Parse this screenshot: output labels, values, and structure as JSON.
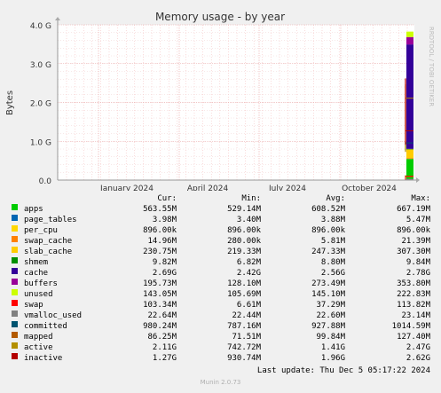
{
  "chart_data": {
    "type": "area",
    "title": "Memory usage - by year",
    "ylabel": "Bytes",
    "side_label": "RRDTOOL / TOBI OETIKER",
    "yticks": [
      "0.0",
      "1.0 G",
      "2.0 G",
      "3.0 G",
      "4.0 G"
    ],
    "ylim": [
      0,
      4.0
    ],
    "xticks": [
      "January 2024",
      "April 2024",
      "July 2024",
      "October 2024"
    ],
    "grid": true,
    "columns": [
      "Cur:",
      "Min:",
      "Avg:",
      "Max:"
    ],
    "series": [
      {
        "name": "apps",
        "color": "#00cc00",
        "cur": "563.55M",
        "min": "529.14M",
        "avg": "608.52M",
        "max": "667.19M"
      },
      {
        "name": "page_tables",
        "color": "#0066b3",
        "cur": "3.98M",
        "min": "3.40M",
        "avg": "3.88M",
        "max": "5.47M"
      },
      {
        "name": "per_cpu",
        "color": "#ffd700",
        "cur": "896.00k",
        "min": "896.00k",
        "avg": "896.00k",
        "max": "896.00k"
      },
      {
        "name": "swap_cache",
        "color": "#ff8000",
        "cur": "14.96M",
        "min": "280.00k",
        "avg": "5.81M",
        "max": "21.39M"
      },
      {
        "name": "slab_cache",
        "color": "#ffcc00",
        "cur": "230.75M",
        "min": "219.33M",
        "avg": "247.33M",
        "max": "307.30M"
      },
      {
        "name": "shmem",
        "color": "#008f00",
        "cur": "9.82M",
        "min": "6.82M",
        "avg": "8.80M",
        "max": "9.84M"
      },
      {
        "name": "cache",
        "color": "#330099",
        "cur": "2.69G",
        "min": "2.42G",
        "avg": "2.56G",
        "max": "2.78G"
      },
      {
        "name": "buffers",
        "color": "#990099",
        "cur": "195.73M",
        "min": "128.10M",
        "avg": "273.49M",
        "max": "353.80M"
      },
      {
        "name": "unused",
        "color": "#ccff00",
        "cur": "143.05M",
        "min": "105.69M",
        "avg": "145.10M",
        "max": "222.83M"
      },
      {
        "name": "swap",
        "color": "#ff0000",
        "cur": "103.34M",
        "min": "6.61M",
        "avg": "37.29M",
        "max": "113.82M"
      },
      {
        "name": "vmalloc_used",
        "color": "#808080",
        "cur": "22.64M",
        "min": "22.44M",
        "avg": "22.60M",
        "max": "23.14M"
      },
      {
        "name": "committed",
        "color": "#005470",
        "cur": "980.24M",
        "min": "787.16M",
        "avg": "927.88M",
        "max": "1014.59M"
      },
      {
        "name": "mapped",
        "color": "#b35a00",
        "cur": "86.25M",
        "min": "71.51M",
        "avg": "99.84M",
        "max": "127.40M"
      },
      {
        "name": "active",
        "color": "#b38f00",
        "cur": "2.11G",
        "min": "742.72M",
        "avg": "1.41G",
        "max": "2.47G"
      },
      {
        "name": "inactive",
        "color": "#b30000",
        "cur": "1.27G",
        "min": "930.74M",
        "avg": "1.96G",
        "max": "2.62G"
      }
    ]
  },
  "footer": {
    "last_update": "Last update: Thu Dec  5 05:17:22 2024",
    "credit": "Munin 2.0.73"
  }
}
